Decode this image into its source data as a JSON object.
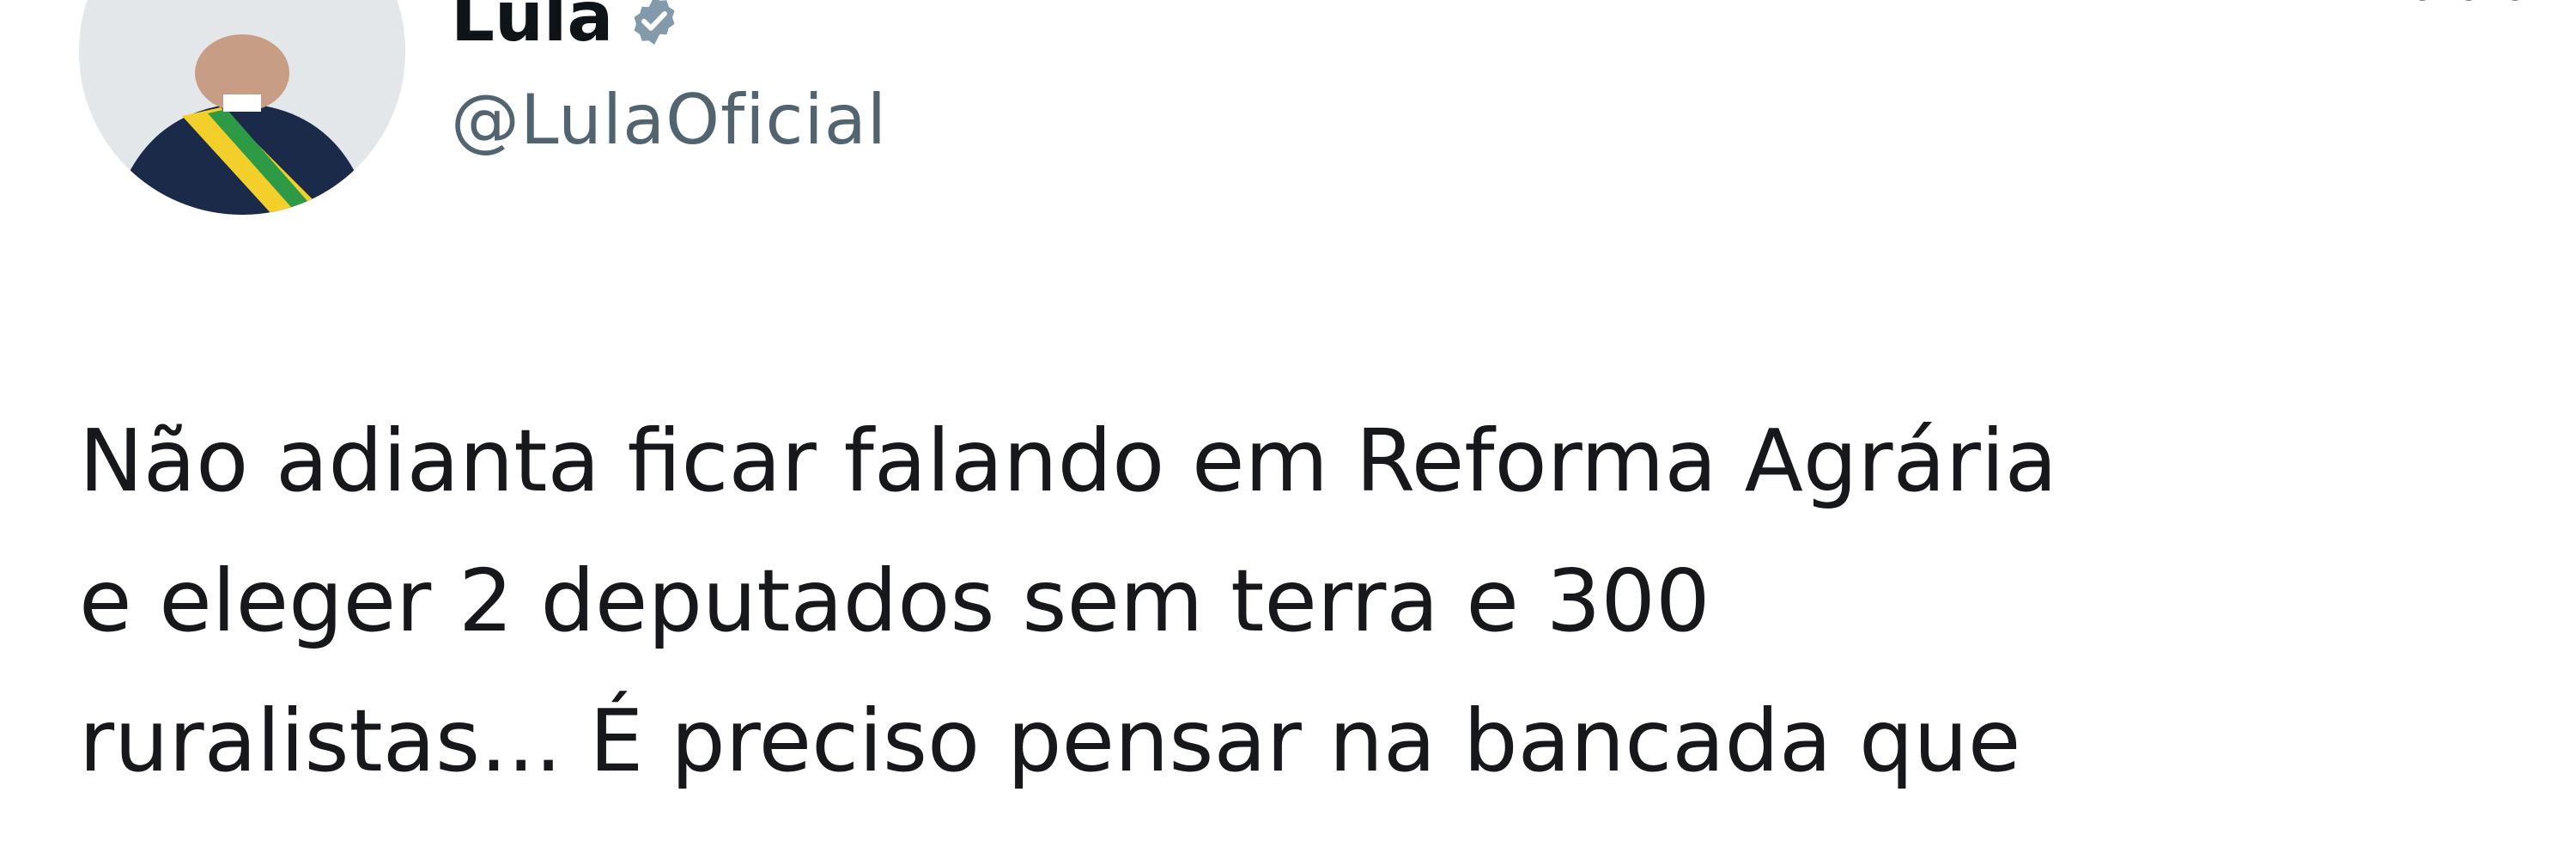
{
  "author": {
    "display_name": "Lula",
    "handle": "@LulaOficial",
    "verified_icon": "verified-badge-icon",
    "avatar_icon": "profile-photo"
  },
  "header": {
    "more_icon": "more-options-icon"
  },
  "tweet": {
    "lines": [
      "Não adianta ficar falando em Reforma Agrária",
      "e eleger 2 deputados sem terra e 300",
      "ruralistas... É preciso pensar na bancada que"
    ]
  },
  "colors": {
    "text": "#0f1419",
    "secondary_text": "#536471",
    "background": "#ffffff",
    "verified_badge": "#829aab"
  }
}
